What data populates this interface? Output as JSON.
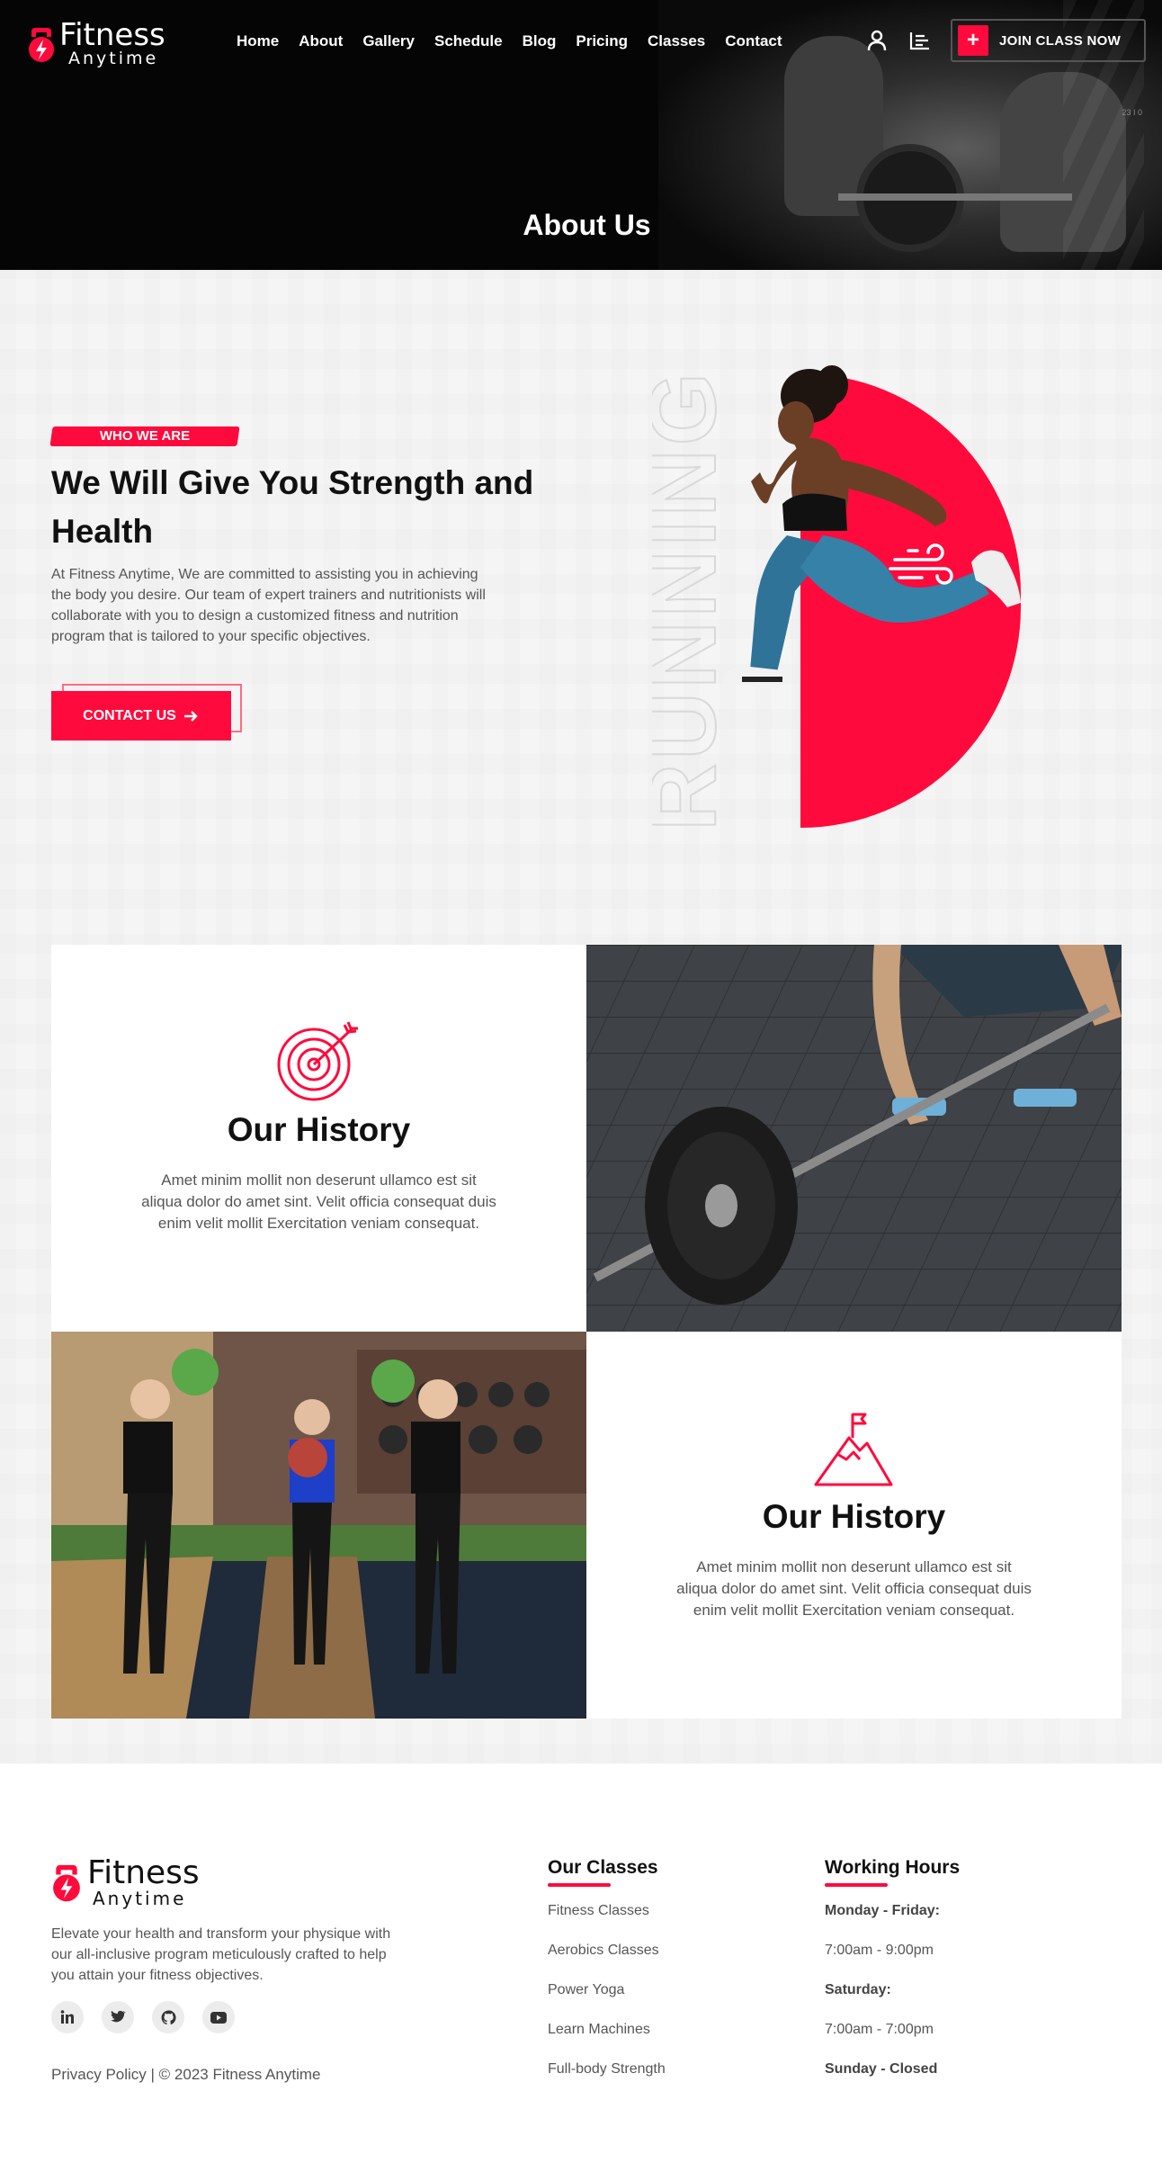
{
  "brand": {
    "name_line1": "Fitness",
    "name_line2": "Anytime",
    "accent": "#ff0a3c"
  },
  "nav": {
    "items": [
      "Home",
      "About",
      "Gallery",
      "Schedule",
      "Blog",
      "Pricing",
      "Classes",
      "Contact"
    ],
    "join_label": "JOIN CLASS NOW",
    "icons": [
      "user-icon",
      "menu-lines-icon",
      "plus-icon"
    ]
  },
  "hero": {
    "title": "About Us",
    "small_text": "23 I 0"
  },
  "about": {
    "badge": "WHO WE ARE",
    "title": "We Will Give You Strength and Health",
    "text": "At Fitness Anytime, We are committed to assisting you in achieving the body you desire. Our team of expert trainers and nutritionists will collaborate with you to design a customized fitness and nutrition program that is tailored to your specific objectives.",
    "contact_label": "CONTACT US",
    "vertical_word": "RUNNING"
  },
  "cards": [
    {
      "title": "Our History",
      "text": "Amet minim mollit non deserunt ullamco est sit aliqua dolor do amet sint. Velit officia consequat duis enim velit mollit Exercitation veniam consequat.",
      "icon": "target-arrow-icon"
    },
    {
      "title": "Our History",
      "text": "Amet minim mollit non deserunt ullamco est sit aliqua dolor do amet sint. Velit officia consequat duis enim velit mollit Exercitation veniam consequat.",
      "icon": "mountain-flag-icon"
    }
  ],
  "footer": {
    "description": "Elevate your health and transform your physique with our all-inclusive program meticulously crafted to help you attain your fitness objectives.",
    "socials": [
      "linkedin-icon",
      "twitter-icon",
      "github-icon",
      "youtube-icon"
    ],
    "privacy": "Privacy Policy",
    "copyright": "| © 2023 Fitness Anytime",
    "classes": {
      "heading": "Our Classes",
      "items": [
        "Fitness Classes",
        "Aerobics Classes",
        "Power Yoga",
        "Learn Machines",
        "Full-body Strength"
      ]
    },
    "hours": {
      "heading": "Working Hours",
      "items": [
        "Monday - Friday:",
        "7:00am - 9:00pm",
        "Saturday:",
        "7:00am - 7:00pm",
        "Sunday - Closed"
      ]
    }
  }
}
